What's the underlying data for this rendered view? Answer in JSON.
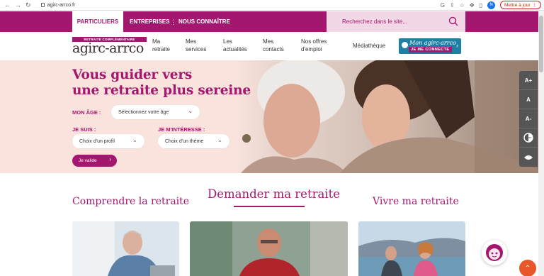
{
  "browser": {
    "url": "agirc-arrco.fr",
    "profile_initial": "N",
    "update_label": "Mettre à jour"
  },
  "topbar": {
    "tabs": [
      "PARTICULIERS",
      "ENTREPRISES",
      "NOUS CONNAÎTRE"
    ],
    "search_placeholder": "Recherchez dans le site..."
  },
  "header": {
    "logo_tagline": "RETRAITE COMPLÉMENTAIRE",
    "logo_text": "agirc-arrco",
    "nav": [
      {
        "l1": "Ma",
        "l2": "retraite"
      },
      {
        "l1": "Mes",
        "l2": "services"
      },
      {
        "l1": "Les",
        "l2": "actualités"
      },
      {
        "l1": "Mes",
        "l2": "contacts"
      },
      {
        "l1": "Nos offres",
        "l2": "d'emploi"
      },
      {
        "l1": "Médiathèque",
        "l2": ""
      }
    ],
    "account_brand": "Mon agirc-arrco",
    "account_cta": "JE ME CONNECTE"
  },
  "hero": {
    "title_line1": "Vous guider vers",
    "title_line2": "une retraite plus sereine",
    "age_label": "MON ÂGE :",
    "age_select": "Sélectionnez votre âge",
    "profile_label": "JE SUIS :",
    "profile_select": "Choix d'un profil",
    "theme_label": "JE M'INTÉRESSE :",
    "theme_select": "Choix d'un thème",
    "submit_label": "Je valide"
  },
  "a11y": {
    "items": [
      "A+",
      "A",
      "A-"
    ]
  },
  "sections": {
    "left": "Comprendre la retraite",
    "center": "Demander ma retraite",
    "right": "Vivre ma retraite"
  },
  "colors": {
    "brand": "#a4176f",
    "hero_bg": "#fbe3dd",
    "account_blue": "#1d7fa3",
    "scroll_top": "#e8572a"
  }
}
